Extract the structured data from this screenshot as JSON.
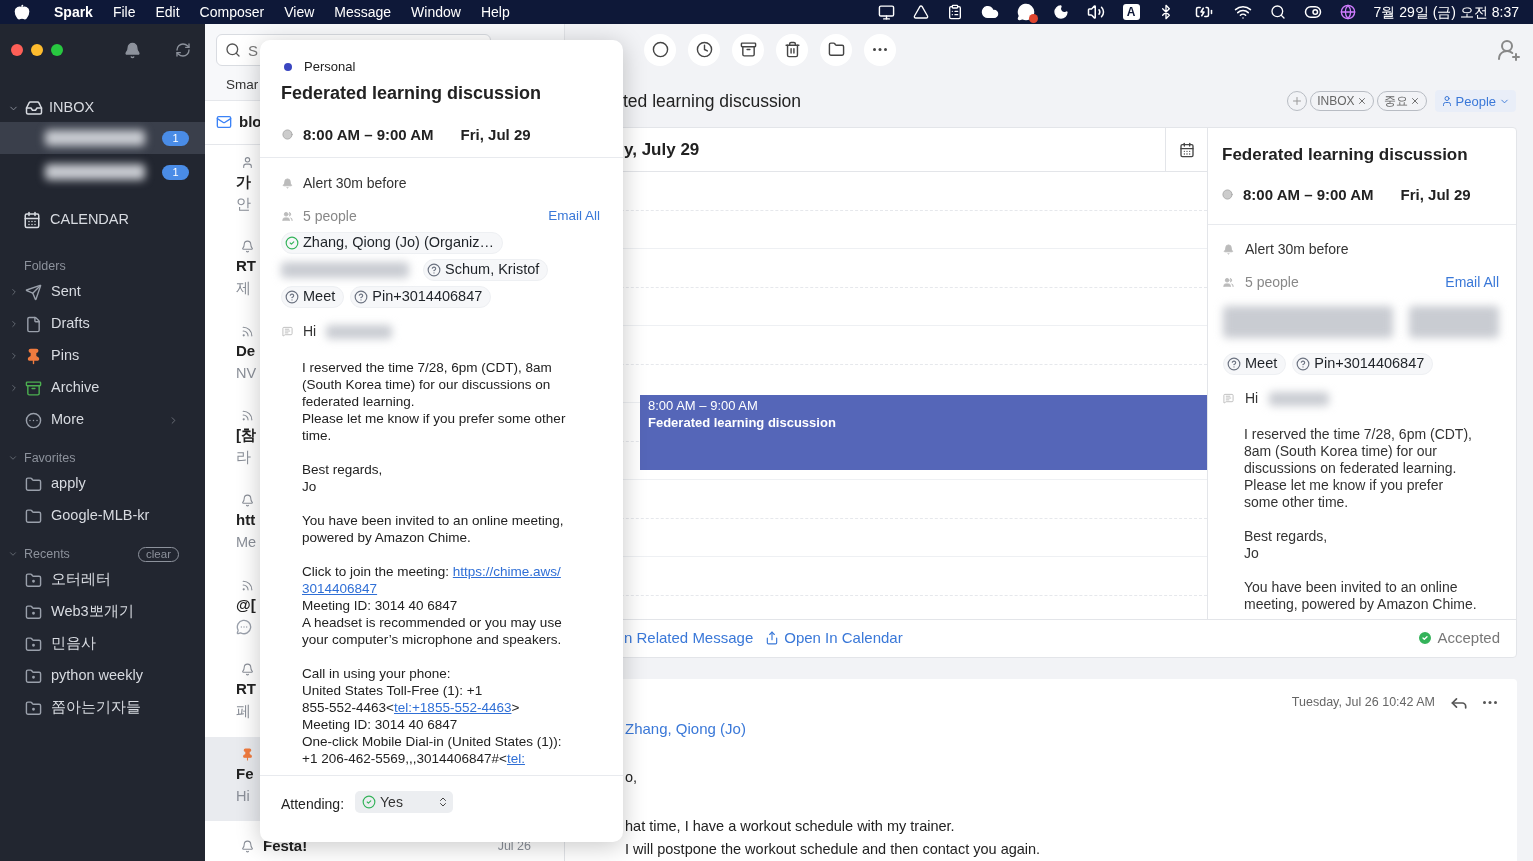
{
  "menu_bar": {
    "app": "Spark",
    "menus": [
      "File",
      "Edit",
      "Composer",
      "View",
      "Message",
      "Window",
      "Help"
    ],
    "input_source": "A",
    "clock": "7월 29일 (금) 오전 8:37"
  },
  "sidebar": {
    "inbox": {
      "label": "INBOX",
      "expanded": true,
      "accounts": [
        {
          "selected": true,
          "badge": "1"
        },
        {
          "selected": false,
          "badge": "1"
        }
      ]
    },
    "calendar": "CALENDAR",
    "sections": [
      {
        "title": "Folders",
        "items": [
          {
            "label": "Sent",
            "kind": "sent"
          },
          {
            "label": "Drafts",
            "kind": "drafts"
          },
          {
            "label": "Pins",
            "kind": "pins"
          },
          {
            "label": "Archive",
            "kind": "archive"
          },
          {
            "label": "More",
            "kind": "more"
          }
        ]
      },
      {
        "title": "Favorites",
        "items": [
          {
            "label": "apply",
            "kind": "folder"
          },
          {
            "label": "Google-MLB-kr",
            "kind": "folder"
          }
        ]
      },
      {
        "title": "Recents",
        "clear": "clear",
        "items": [
          {
            "label": "오터레터",
            "kind": "recent"
          },
          {
            "label": "Web3뽀개기",
            "kind": "recent"
          },
          {
            "label": "민음사",
            "kind": "recent"
          },
          {
            "label": "python weekly",
            "kind": "recent"
          },
          {
            "label": "쫌아는기자들",
            "kind": "recent"
          }
        ]
      }
    ]
  },
  "message_list": {
    "search_placeholder": "S",
    "tab": "Smar",
    "rows": [
      {
        "kind": "mail",
        "title": "blo",
        "selected": false
      },
      {
        "kind": "person",
        "title": "가",
        "preview": "안",
        "selected": false
      },
      {
        "kind": "bell",
        "title": "RT",
        "preview": "제",
        "selected": false
      },
      {
        "kind": "rss",
        "title": "De",
        "preview": "NV",
        "selected": false
      },
      {
        "kind": "rss",
        "title": "[참",
        "preview": "라",
        "selected": false
      },
      {
        "kind": "bell",
        "title": "htt",
        "preview": "Me",
        "selected": false
      },
      {
        "kind": "rss",
        "title": "@[",
        "chat_icon": true,
        "selected": false
      },
      {
        "kind": "bell",
        "title": "RT",
        "preview": "페",
        "selected": false
      },
      {
        "kind": "pin",
        "title": "Fe",
        "preview": "Hi",
        "selected": true
      },
      {
        "kind": "bell",
        "title": "Festa!",
        "date": "Jul 26",
        "selected": false
      }
    ]
  },
  "thread": {
    "subject": "ted learning discussion",
    "tags": [
      {
        "label": "INBOX"
      },
      {
        "label": "중요"
      }
    ],
    "people": "People",
    "calendar": {
      "header": "y, July 29",
      "event": {
        "time": "8:00 AM – 9:00 AM",
        "title": "Federated learning discussion"
      }
    },
    "details": {
      "title": "Federated learning discussion",
      "time": "8:00 AM – 9:00 AM",
      "date": "Fri, Jul 29",
      "alert": "Alert 30m before",
      "people_count": "5 people",
      "email_all": "Email All",
      "chips": [
        {
          "label": "Meet",
          "kind": "unknown"
        },
        {
          "label": "Pin+3014406847",
          "kind": "unknown"
        }
      ],
      "greeting": "Hi",
      "paragraphs": [
        [
          "I reserved the time 7/28, 6pm (CDT),",
          "8am (South Korea time) for our",
          "discussions on federated learning.",
          "Please let me know if you prefer",
          "some other time."
        ],
        [
          "Best regards,",
          "Jo"
        ],
        [
          "You have been invited to an online",
          "meeting, powered by Amazon Chime."
        ]
      ]
    },
    "actions": [
      {
        "label": "n Related Message",
        "kind": "plain"
      },
      {
        "label": "Open In Calendar",
        "kind": "share"
      }
    ],
    "status": "Accepted",
    "message": {
      "date": "Tuesday, Jul 26 10:42 AM",
      "from": "Zhang, Qiong (Jo)",
      "lines": [
        "o,",
        "hat time, I have a workout schedule with my trainer.",
        "I will postpone the workout schedule and then contact you again."
      ]
    }
  },
  "popup": {
    "calendar": "Personal",
    "title": "Federated learning discussion",
    "time": "8:00 AM – 9:00 AM",
    "date": "Fri, Jul 29",
    "alert": "Alert 30m before",
    "people_count": "5 people",
    "email_all": "Email All",
    "attendees": [
      {
        "name": "Zhang, Qiong (Jo) (Organiz…",
        "kind": "accepted"
      },
      {
        "name": "Schum, Kristof",
        "kind": "unknown"
      },
      {
        "name": "Meet",
        "kind": "unknown"
      },
      {
        "name": "Pin+3014406847",
        "kind": "unknown"
      }
    ],
    "greeting": "Hi",
    "paragraphs": [
      [
        "I reserved the time 7/28, 6pm (CDT), 8am",
        "(South Korea time) for our discussions on",
        "federated learning.",
        "Please let me know if you prefer some other",
        "time."
      ],
      [
        "Best regards,",
        "Jo"
      ],
      [
        "You have been invited to an online meeting,",
        "powered by Amazon Chime."
      ],
      [
        [
          {
            "text": "Click to join the meeting: "
          },
          {
            "text": "https://chime.aws/",
            "kind": "link"
          }
        ],
        [
          {
            "text": "3014406847",
            "kind": "link"
          }
        ],
        "Meeting ID: 3014 40 6847",
        "A headset is recommended or you may use",
        "your computer’s microphone and speakers."
      ],
      [
        "Call in using your phone:",
        "United States Toll-Free (1): +1",
        [
          {
            "text": "855-552-4463<"
          },
          {
            "text": "tel:+1855-552-4463",
            "kind": "link"
          },
          {
            "text": ">"
          }
        ],
        "Meeting ID: 3014 40 6847",
        "One-click Mobile Dial-in (United States (1)):",
        [
          {
            "text": "+1 206-462-5569,,,3014406847#<"
          },
          {
            "text": "tel:",
            "kind": "link"
          }
        ]
      ]
    ],
    "attending_label": "Attending:",
    "attending": "Yes"
  }
}
